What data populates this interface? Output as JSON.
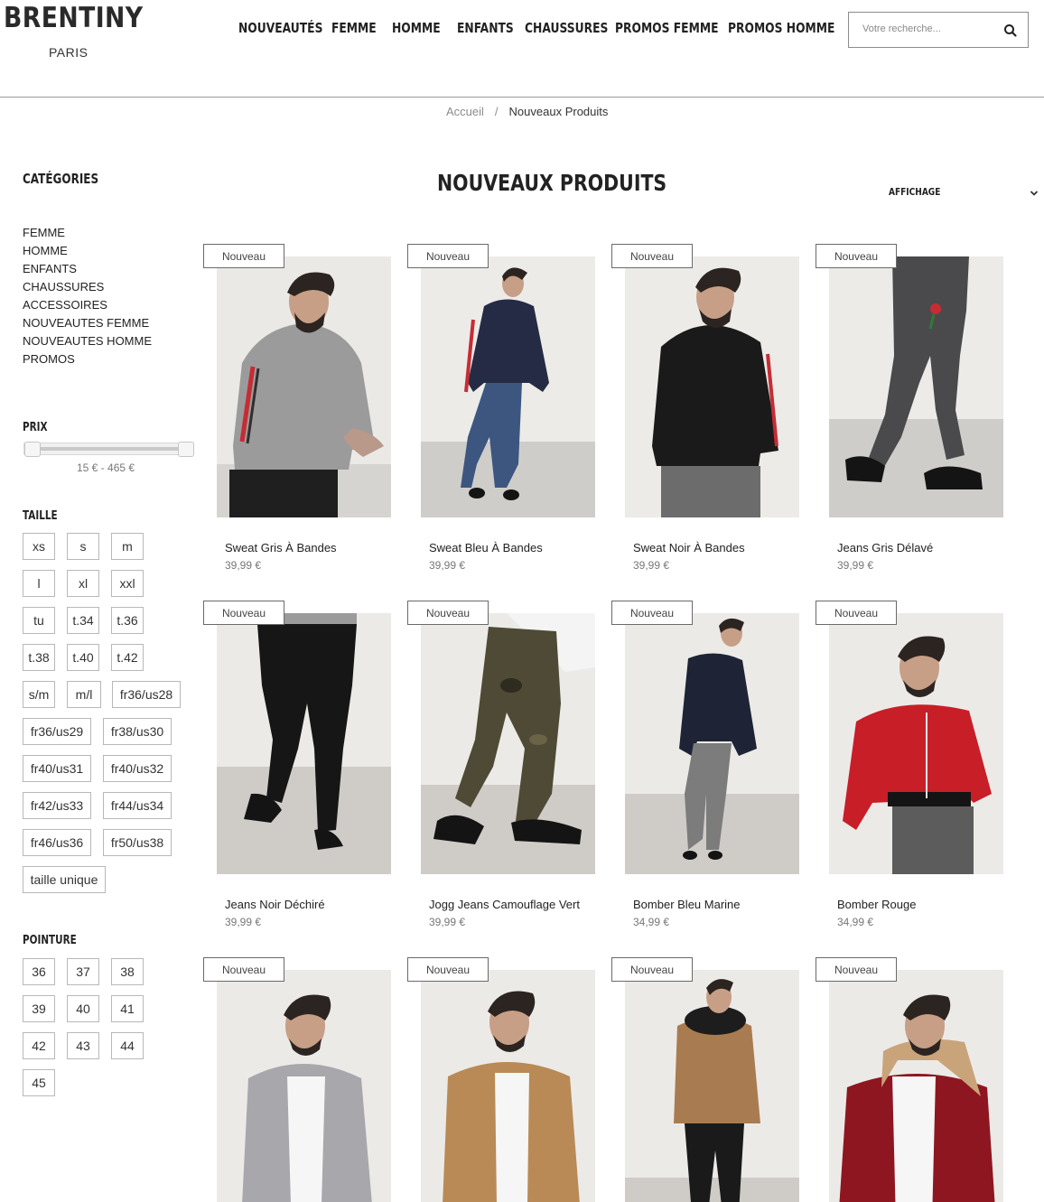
{
  "brand": {
    "name": "BRENTINY",
    "city": "PARIS"
  },
  "nav": [
    "NOUVEAUTÉS",
    "FEMME",
    "HOMME",
    "ENFANTS",
    "CHAUSSURES",
    "PROMOS FEMME",
    "PROMOS HOMME"
  ],
  "search": {
    "placeholder": "Votre recherche..."
  },
  "breadcrumb": {
    "home": "Accueil",
    "separator": "/",
    "current": "Nouveaux Produits"
  },
  "sidebar": {
    "categories_title": "CATÉGORIES",
    "categories": [
      "FEMME",
      "HOMME",
      "ENFANTS",
      "CHAUSSURES",
      "ACCESSOIRES",
      "NOUVEAUTES FEMME",
      "NOUVEAUTES HOMME",
      "PROMOS"
    ],
    "price_title": "PRIX",
    "price_range": "15 € - 465 €",
    "price_min": 15,
    "price_max": 465,
    "size_title": "TAILLE",
    "sizes": [
      "xs",
      "s",
      "m",
      "l",
      "xl",
      "xxl",
      "tu",
      "t.34",
      "t.36",
      "t.38",
      "t.40",
      "t.42",
      "s/m",
      "m/l",
      "fr36/us28",
      "fr36/us29",
      "fr38/us30",
      "fr40/us31",
      "fr40/us32",
      "fr42/us33",
      "fr44/us34",
      "fr46/us36",
      "fr50/us38",
      "taille unique"
    ],
    "shoe_title": "POINTURE",
    "shoe_sizes": [
      "36",
      "37",
      "38",
      "39",
      "40",
      "41",
      "42",
      "43",
      "44",
      "45"
    ]
  },
  "main": {
    "title": "NOUVEAUX PRODUITS",
    "display_label": "AFFICHAGE"
  },
  "colors": {
    "accent_red": "#c62c34",
    "price_grey": "#777777",
    "border_grey": "#b8b8b8"
  },
  "products": [
    {
      "badge": "Nouveau",
      "name": "Sweat Gris À Bandes",
      "price": "39,99 €",
      "image": "grey-hoodie"
    },
    {
      "badge": "Nouveau",
      "name": "Sweat Bleu À Bandes",
      "price": "39,99 €",
      "image": "navy-hoodie"
    },
    {
      "badge": "Nouveau",
      "name": "Sweat Noir À Bandes",
      "price": "39,99 €",
      "image": "black-hoodie"
    },
    {
      "badge": "Nouveau",
      "name": "Jeans Gris Délavé",
      "price": "39,99 €",
      "image": "grey-jeans"
    },
    {
      "badge": "Nouveau",
      "name": "Jeans Noir Déchiré",
      "price": "39,99 €",
      "image": "black-jeans"
    },
    {
      "badge": "Nouveau",
      "name": "Jogg Jeans Camouflage Vert",
      "price": "39,99 €",
      "image": "camo-jogger"
    },
    {
      "badge": "Nouveau",
      "name": "Bomber Bleu Marine",
      "price": "34,99 €",
      "image": "navy-bomber"
    },
    {
      "badge": "Nouveau",
      "name": "Bomber Rouge",
      "price": "34,99 €",
      "image": "red-bomber"
    },
    {
      "badge": "Nouveau",
      "image": "grey-bomber"
    },
    {
      "badge": "Nouveau",
      "image": "camel-bomber"
    },
    {
      "badge": "Nouveau",
      "image": "camel-parka"
    },
    {
      "badge": "Nouveau",
      "image": "red-parka"
    }
  ]
}
